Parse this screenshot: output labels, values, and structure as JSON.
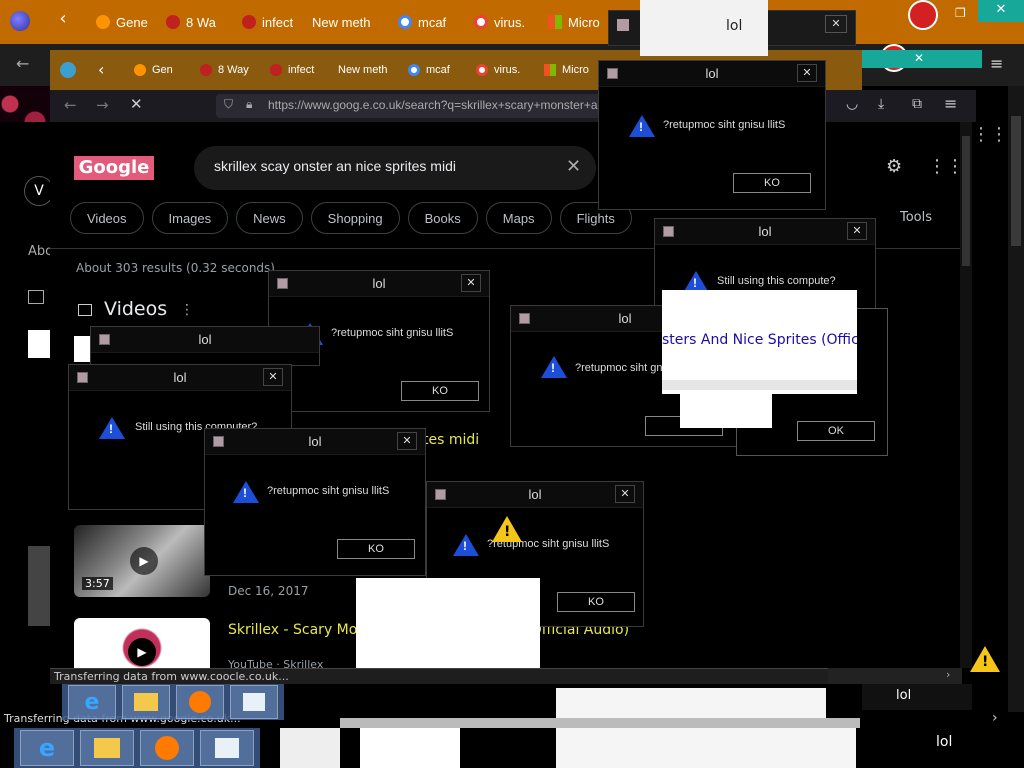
{
  "browser_outer": {
    "tabs": [
      "Gene",
      "8 Wa",
      "infect",
      "New meth",
      "mcaf",
      "virus.",
      "Micro"
    ],
    "tab_icons": [
      "firefox-icon",
      "chrome-icon",
      "warning-shield-icon",
      "warning-shield-icon",
      "none",
      "google-icon",
      "google-icon",
      "microsoft-icon"
    ]
  },
  "browser_inner_tabs": [
    "Gen",
    "8 Way",
    "infect",
    "New meth",
    "mcaf",
    "virus.",
    "Micro"
  ],
  "browser_third": {
    "url": "https://www.goog.e.co.uk/search?q=skrillex+scary+monster+a"
  },
  "google": {
    "logo_text": "Google",
    "query": "skrillex scay onster an nice sprites midi",
    "chips": [
      "Videos",
      "Images",
      "News",
      "Shopping",
      "Books",
      "Maps",
      "Flights"
    ],
    "tools_label": "Tools",
    "results_stats": "About 303 results (0.32 seconds)",
    "videos_heading": "Videos",
    "partial_result_title": "tes midi",
    "video_duration": "3:57",
    "video_date": "Dec 16, 2017",
    "result_link": "Skrillex - Scary Monsters And Nice Sprites (Official Audio)",
    "result_source": "YouTube · Skrillex",
    "glitch_link": "sters And Nice Sprites (Official",
    "left_stub_about": "Abo",
    "left_stub_v": "V"
  },
  "dialogs": [
    {
      "title": "lol",
      "message": "?retupmoc siht gnisu llitS",
      "ok": "KO"
    },
    {
      "title": "lol",
      "message": "Still using this compute?",
      "ok": ""
    },
    {
      "title": "lol",
      "message": "?retupmoc siht gnisu llitS",
      "ok": "KO"
    },
    {
      "title": "lol",
      "message": "",
      "ok": ""
    },
    {
      "title": "lol",
      "message": "Still using this computer?",
      "ok": ""
    },
    {
      "title": "lol",
      "message": "?retupmoc siht gnisu llitS",
      "ok": "KO"
    },
    {
      "title": "lol",
      "message": "?retupmoc siht gni",
      "ok": ""
    },
    {
      "title": "lol",
      "message": "?retupmoc siht gnisu llitS",
      "ok": "KO"
    },
    {
      "title": "lol",
      "message": "",
      "ok": "OK"
    }
  ],
  "top_glitch_title": "lol",
  "status_texts": [
    "Transferring data from www.coocle.co.uk...",
    "Transferring data from www.google.co.uk..."
  ],
  "bottom_lol": [
    "lol",
    "lol"
  ],
  "colors": {
    "orange_bar": "#c06a00",
    "dark_orange": "#8a5a0e",
    "link_yellow": "#e8e84a"
  }
}
